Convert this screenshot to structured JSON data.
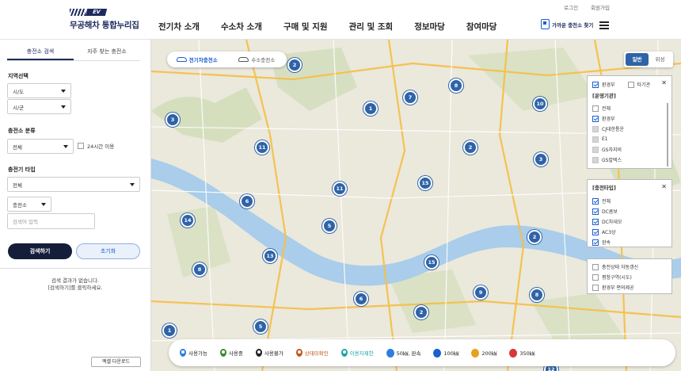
{
  "header": {
    "logo_badge": "EV",
    "logo_title": "무공해차 통합누리집",
    "util": [
      "로그인",
      "회원가입"
    ],
    "nav": [
      "전기차 소개",
      "수소차 소개",
      "구매 및 지원",
      "관리 및 조회",
      "정보마당",
      "참여마당"
    ],
    "near_button": "가까운 충전소 찾기"
  },
  "sidebar": {
    "tabs": [
      "충전소 검색",
      "자주 찾는 충전소"
    ],
    "region_label": "지역선택",
    "sido": "시/도",
    "sigungu": "시/군",
    "class_label": "충전소 분류",
    "class_value": "전체",
    "open24": "24시간 이용",
    "type_label": "충전기 타입",
    "type_value": "전체",
    "search_by": "충전소",
    "input_placeholder": "검색어 입력",
    "search_btn": "검색하기",
    "reset_btn": "초기화",
    "empty_line1": "검색 결과가 없습니다.",
    "empty_line2": "[검색하기]를 클릭하세요.",
    "excel_btn": "엑셀 다운로드"
  },
  "map": {
    "vehicle_tabs": [
      "전기차충전소",
      "수소충전소"
    ],
    "map_types": [
      "일반",
      "위성"
    ],
    "clusters": [
      {
        "n": "2"
      },
      {
        "n": "8"
      },
      {
        "n": "7"
      },
      {
        "n": "1"
      },
      {
        "n": "10"
      },
      {
        "n": "3"
      },
      {
        "n": "11"
      },
      {
        "n": "2"
      },
      {
        "n": "3"
      },
      {
        "n": "11"
      },
      {
        "n": "15"
      },
      {
        "n": "6"
      },
      {
        "n": "14"
      },
      {
        "n": "5"
      },
      {
        "n": "2"
      },
      {
        "n": "13"
      },
      {
        "n": "8"
      },
      {
        "n": "15"
      },
      {
        "n": "6"
      },
      {
        "n": "9"
      },
      {
        "n": "8"
      },
      {
        "n": "1"
      },
      {
        "n": "5"
      },
      {
        "n": "2"
      },
      {
        "n": "12"
      }
    ]
  },
  "operator_panel": {
    "top_checks": [
      {
        "label": "환경부",
        "checked": true
      },
      {
        "label": "타기관",
        "checked": false
      }
    ],
    "title": "[운영기관]",
    "items": [
      {
        "label": "전체",
        "checked": false
      },
      {
        "label": "환경부",
        "checked": true
      },
      {
        "label": "CJ대한통운",
        "checked": false
      },
      {
        "label": "E1",
        "checked": false
      },
      {
        "label": "GS차지비",
        "checked": false
      },
      {
        "label": "GS칼텍스",
        "checked": false
      }
    ]
  },
  "type_panel": {
    "title": "[충전타입]",
    "items": [
      {
        "label": "전체",
        "checked": true
      },
      {
        "label": "DC콤보",
        "checked": true
      },
      {
        "label": "DC차데모",
        "checked": true
      },
      {
        "label": "AC3상",
        "checked": true
      },
      {
        "label": "완속",
        "checked": true
      }
    ]
  },
  "extra_panel": {
    "items": [
      "충전상태 자동갱신",
      "평창구역(시도)",
      "환경부 편의제공"
    ]
  },
  "legend": [
    {
      "label": "사용가능",
      "color": "#2f7de1"
    },
    {
      "label": "사용중",
      "color": "#3c8c2e"
    },
    {
      "label": "사용불가",
      "color": "#222222"
    },
    {
      "label": "상태미확인",
      "color": "#c0581d"
    },
    {
      "label": "이용자제한",
      "color": "#1aa6a6"
    },
    {
      "label": "50㎾, 완속",
      "color": "#2f7de1"
    },
    {
      "label": "100㎾",
      "color": "#1c5fcf"
    },
    {
      "label": "200㎾",
      "color": "#e6a21b"
    },
    {
      "label": "350㎾",
      "color": "#d93636"
    }
  ]
}
